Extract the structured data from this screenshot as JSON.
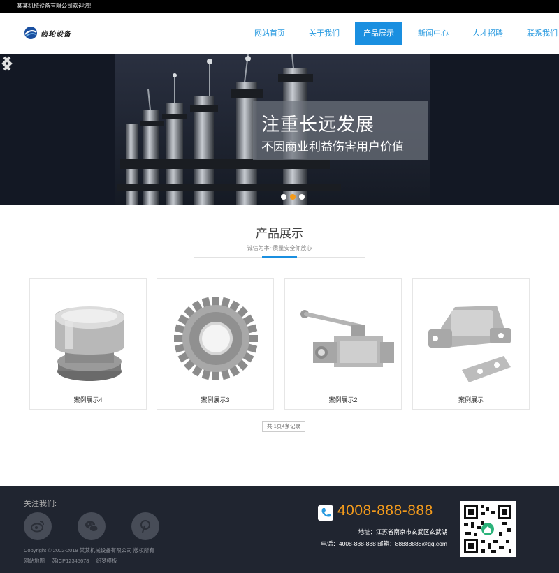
{
  "topbar": {
    "welcome": "某某机械设备有限公司欢迎您!"
  },
  "header": {
    "logo_text": "齿轮设备",
    "nav": [
      {
        "label": "网站首页"
      },
      {
        "label": "关于我们"
      },
      {
        "label": "产品展示",
        "active": true
      },
      {
        "label": "新闻中心"
      },
      {
        "label": "人才招聘"
      },
      {
        "label": "联系我们"
      }
    ]
  },
  "banner": {
    "title": "注重长远发展",
    "subtitle": "不因商业利益伤害用户价值",
    "slide_count": 3,
    "active_slide": 2
  },
  "section": {
    "title": "产品展示",
    "subtitle": "诚信为本~质量安全你放心"
  },
  "products": [
    {
      "label": "案例展示4",
      "image": "breather-cap"
    },
    {
      "label": "案例展示3",
      "image": "spur-gear"
    },
    {
      "label": "案例展示2",
      "image": "ball-valve"
    },
    {
      "label": "案例展示",
      "image": "hinge-latch"
    }
  ],
  "pagination": {
    "text": "共 1页4条记录"
  },
  "footer": {
    "follow_label": "关注我们:",
    "social": [
      {
        "icon": "weibo-icon"
      },
      {
        "icon": "wechat-icon"
      },
      {
        "icon": "pinterest-icon"
      }
    ],
    "copyright": "Copyright © 2002-2019 某某机械设备有限公司 版权所有",
    "links": [
      "网站地图",
      "苏ICP12345678",
      "织梦模板"
    ],
    "phone": "4008-888-888",
    "address": "地址：江苏省南京市玄武区玄武湖",
    "contact": "电话：4008-888-888 邮箱：88888888@qq.com"
  },
  "colors": {
    "accent": "#1a8fe0",
    "orange": "#f39b1c",
    "footer_bg": "#202530",
    "nav_text": "#2a9be0"
  }
}
